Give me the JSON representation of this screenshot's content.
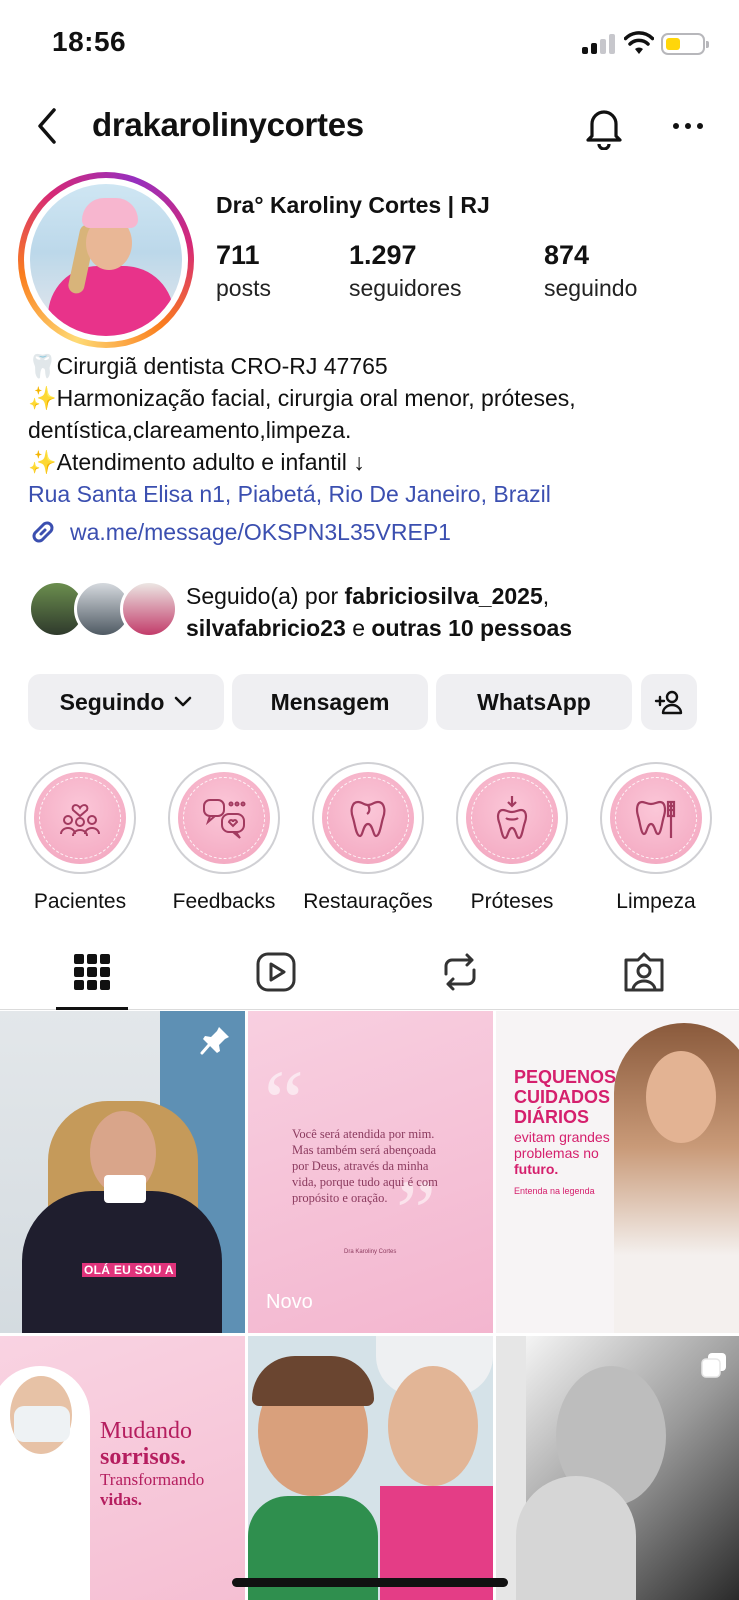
{
  "status_bar": {
    "time": "18:56"
  },
  "header": {
    "username": "drakarolinycortes"
  },
  "profile": {
    "display_name": "Dra° Karoliny Cortes | RJ",
    "stats": [
      {
        "value": "711",
        "label": "posts"
      },
      {
        "value": "1.297",
        "label": "seguidores"
      },
      {
        "value": "874",
        "label": "seguindo"
      }
    ],
    "bio": [
      "🦷Cirurgiã dentista CRO-RJ 47765",
      "✨Harmonização facial, cirurgia oral menor, próteses,",
      "dentística,clareamento,limpeza.",
      "✨Atendimento adulto e infantil ↓"
    ],
    "address": "Rua Santa Elisa n1, Piabetá, Rio De Janeiro, Brazil",
    "link": "wa.me/message/OKSPN3L35VREP1",
    "followed_by": {
      "prefix": "Seguido(a) por ",
      "user1": "fabriciosilva_2025",
      "sep": ",",
      "user2": "silvafabricio23",
      "conj": " e ",
      "others": "outras 10 pessoas"
    }
  },
  "buttons": {
    "following": "Seguindo",
    "message": "Mensagem",
    "whatsapp": "WhatsApp"
  },
  "highlights": [
    {
      "label": "Pacientes",
      "icon": "people-heart-icon"
    },
    {
      "label": "Feedbacks",
      "icon": "chat-bubbles-icon"
    },
    {
      "label": "Restaurações",
      "icon": "tooth-icon"
    },
    {
      "label": "Próteses",
      "icon": "tooth-implant-icon"
    },
    {
      "label": "Limpeza",
      "icon": "tooth-brush-icon"
    }
  ],
  "tabs": [
    "grid-icon",
    "reels-icon",
    "reposts-icon",
    "tagged-icon"
  ],
  "posts": {
    "p1": {
      "caption": "OLÁ EU SOU A"
    },
    "p2": {
      "quote": "Você será atendida por mim. Mas também será abençoada por Deus, através da minha vida, porque tudo aqui é com propósito e oração.",
      "signature": "Dra Karoliny Cortes",
      "badge": "Novo"
    },
    "p3": {
      "headline": [
        "PEQUENOS",
        "CUIDADOS",
        "DIÁRIOS"
      ],
      "sub": [
        "evitam grandes",
        "problemas no"
      ],
      "sub_bold": "futuro.",
      "small": "Entenda na legenda"
    },
    "p4": {
      "line1": "Mudando",
      "line2": "sorrisos.",
      "line3": "Transformando",
      "line4": "vidas."
    }
  },
  "colors": {
    "link": "#3b4fb0",
    "button_bg": "#efeff2",
    "brand_pink": "#d5206d"
  }
}
